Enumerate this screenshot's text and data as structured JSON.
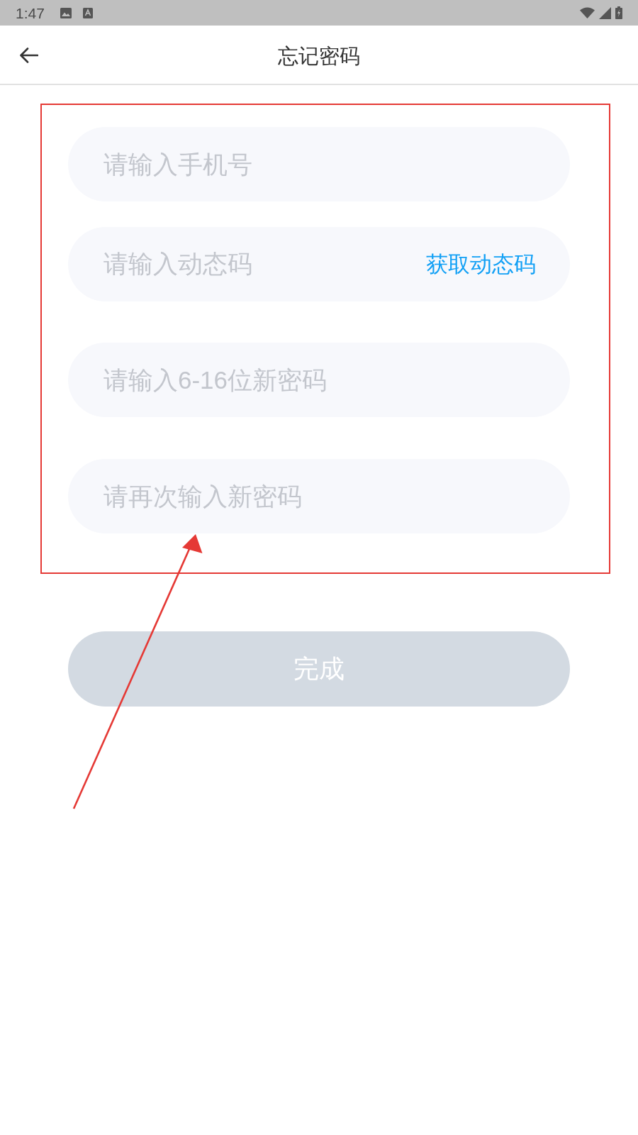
{
  "status_bar": {
    "time": "1:47"
  },
  "header": {
    "title": "忘记密码"
  },
  "form": {
    "fields": [
      {
        "kind": "text",
        "placeholder": "请输入手机号"
      },
      {
        "kind": "code",
        "placeholder": "请输入动态码",
        "action": "获取动态码"
      },
      {
        "kind": "password",
        "placeholder": "请输入6-16位新密码"
      },
      {
        "kind": "password",
        "placeholder": "请再次输入新密码"
      }
    ]
  },
  "submit_button": {
    "label": "完成",
    "disabled": true
  }
}
